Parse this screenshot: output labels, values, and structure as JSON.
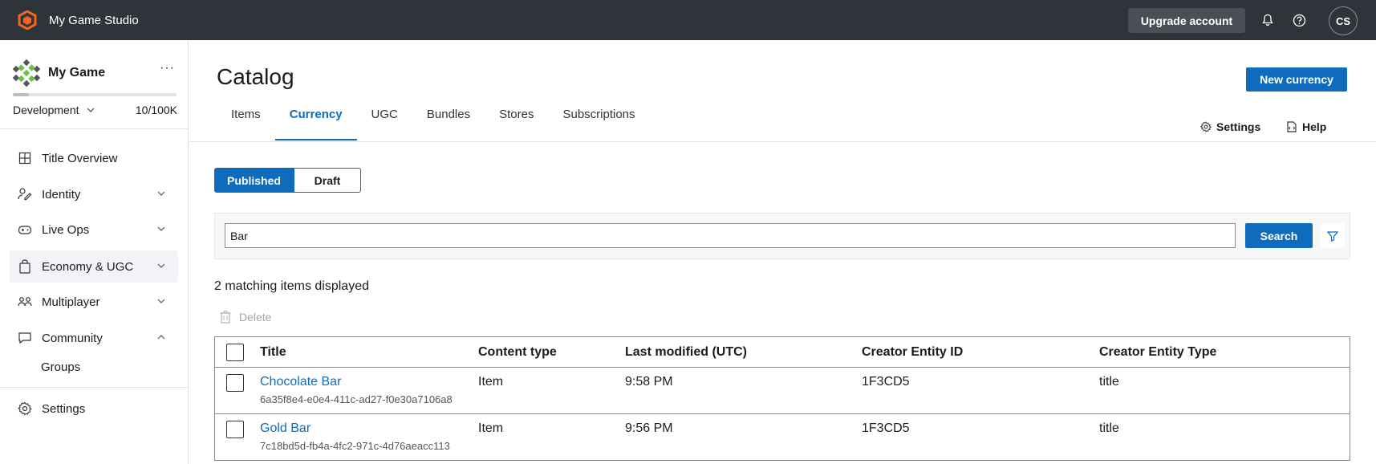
{
  "topbar": {
    "studio_name": "My Game Studio",
    "upgrade_label": "Upgrade account",
    "avatar_initials": "CS",
    "brand_color": "#f26522"
  },
  "sidebar": {
    "game_name": "My Game",
    "more_label": "···",
    "environment": "Development",
    "usage": "10/100K",
    "usage_fraction": 0.1,
    "items": [
      {
        "label": "Title Overview",
        "icon": "grid-icon",
        "chevron": "none"
      },
      {
        "label": "Identity",
        "icon": "identity-icon",
        "chevron": "down"
      },
      {
        "label": "Live Ops",
        "icon": "gamepad-icon",
        "chevron": "down"
      },
      {
        "label": "Economy & UGC",
        "icon": "bag-icon",
        "chevron": "down",
        "active": true
      },
      {
        "label": "Multiplayer",
        "icon": "people-icon",
        "chevron": "down"
      },
      {
        "label": "Community",
        "icon": "chat-icon",
        "chevron": "up"
      }
    ],
    "sub_items": [
      {
        "label": "Groups"
      }
    ],
    "settings_label": "Settings"
  },
  "main": {
    "title": "Catalog",
    "new_button": "New currency",
    "tabs": [
      {
        "label": "Items"
      },
      {
        "label": "Currency",
        "active": true
      },
      {
        "label": "UGC"
      },
      {
        "label": "Bundles"
      },
      {
        "label": "Stores"
      },
      {
        "label": "Subscriptions"
      }
    ],
    "settings_link": "Settings",
    "help_link": "Help",
    "segment": {
      "published": "Published",
      "draft": "Draft"
    },
    "search": {
      "value": "Bar",
      "button": "Search"
    },
    "match_text": "2 matching items displayed",
    "delete_label": "Delete",
    "table": {
      "columns": [
        "Title",
        "Content type",
        "Last modified (UTC)",
        "Creator Entity ID",
        "Creator Entity Type"
      ],
      "rows": [
        {
          "title": "Chocolate Bar",
          "id": "6a35f8e4-e0e4-411c-ad27-f0e30a7106a8",
          "content_type": "Item",
          "modified": "9:58 PM",
          "creator_id": "1F3CD5",
          "creator_type": "title"
        },
        {
          "title": "Gold Bar",
          "id": "7c18bd5d-fb4a-4fc2-971c-4d76aeacc113",
          "content_type": "Item",
          "modified": "9:56 PM",
          "creator_id": "1F3CD5",
          "creator_type": "title"
        }
      ]
    }
  },
  "accent_color": "#0f6cbd"
}
